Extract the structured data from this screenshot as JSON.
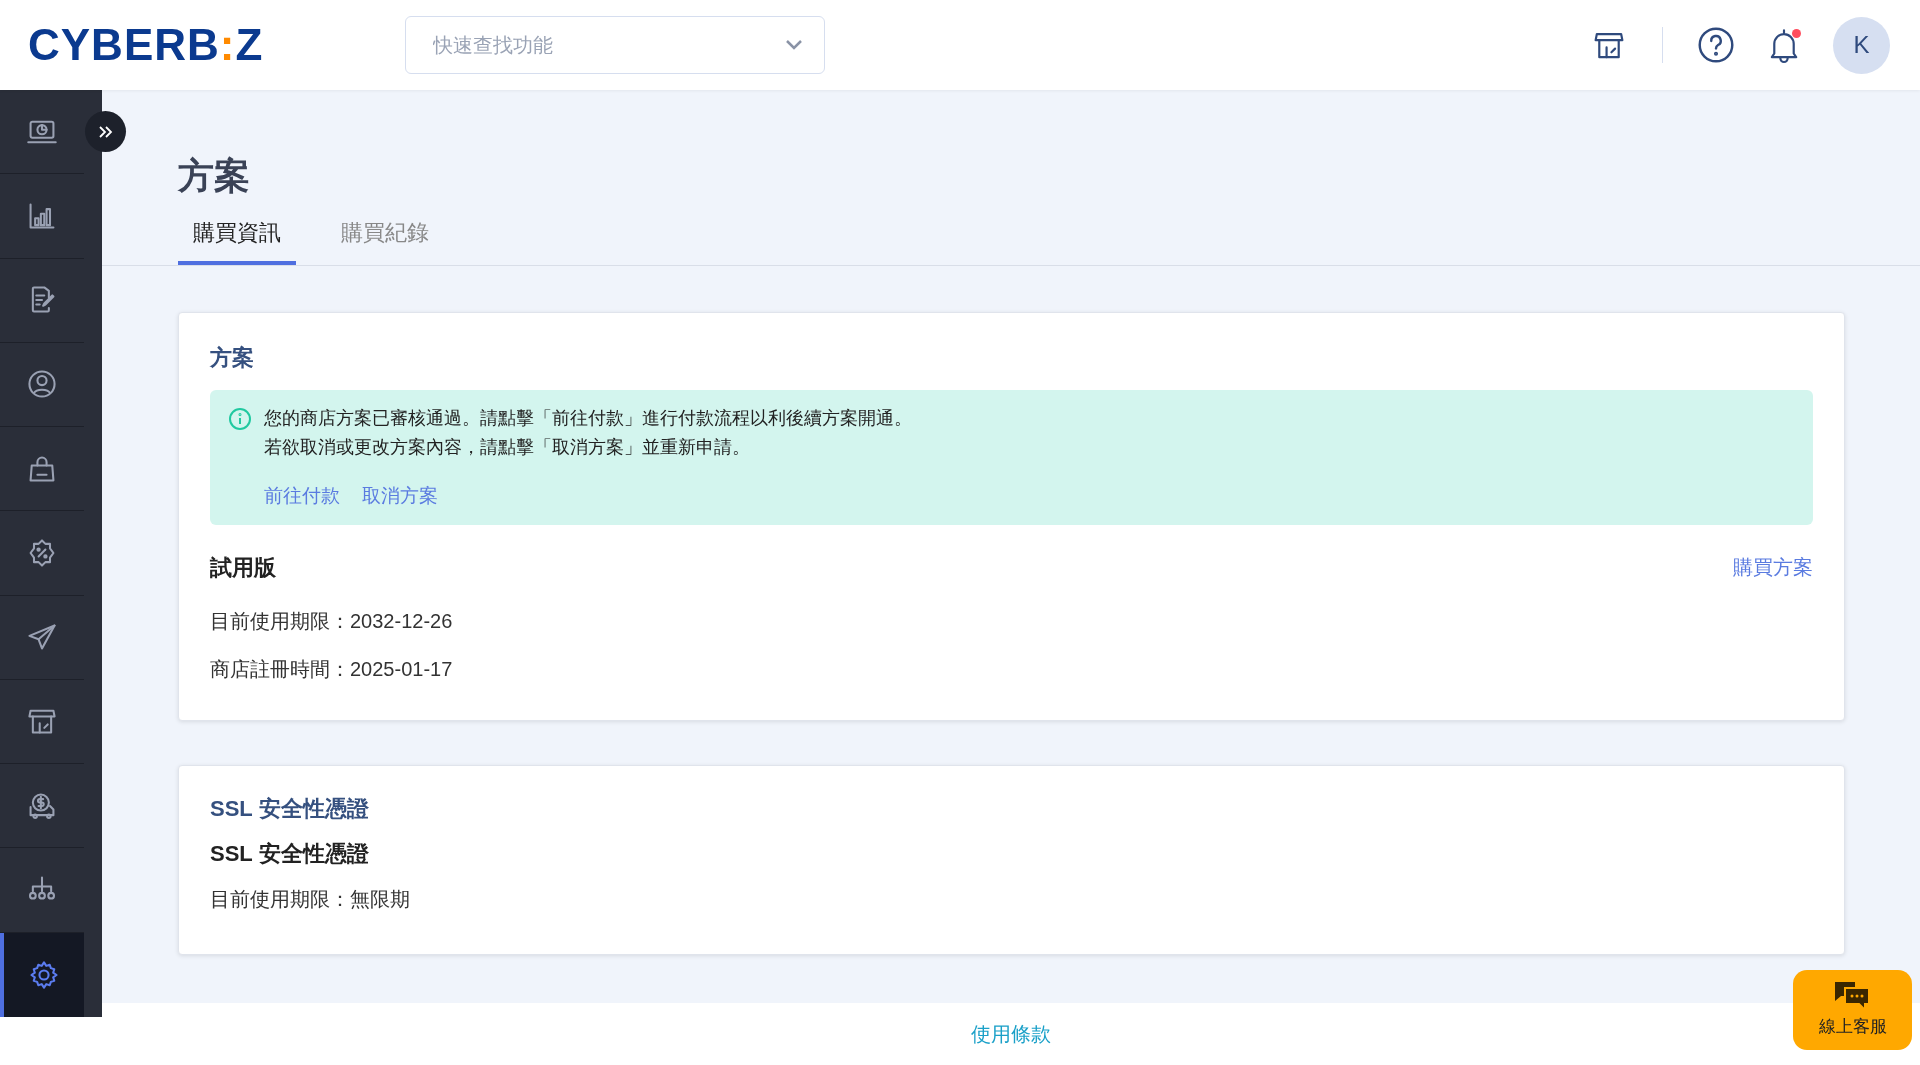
{
  "header": {
    "logo": {
      "before": "CYBERB",
      "mark": ":",
      "after": "Z"
    },
    "search": {
      "placeholder": "快速查找功能"
    },
    "notification_unread": true,
    "avatar": "K"
  },
  "sidebar": {
    "items": [
      {
        "selected": false
      },
      {
        "selected": false
      },
      {
        "selected": false
      },
      {
        "selected": false
      },
      {
        "selected": false
      },
      {
        "selected": false
      },
      {
        "selected": false
      },
      {
        "selected": false
      },
      {
        "selected": false
      },
      {
        "selected": false
      },
      {
        "selected": true
      }
    ]
  },
  "page": {
    "title": "方案",
    "tabs": [
      {
        "label": "購買資訊",
        "selected": true
      },
      {
        "label": "購買紀錄",
        "selected": false
      }
    ]
  },
  "plan_card": {
    "heading": "方案",
    "notice": {
      "lines": [
        "您的商店方案已審核通過。請點擊「前往付款」進行付款流程以利後續方案開通。",
        "若欲取消或更改方案內容，請點擊「取消方案」並重新申請。"
      ],
      "links": [
        "前往付款",
        "取消方案"
      ]
    },
    "plan_name": "試用版",
    "action": "購買方案",
    "details": [
      "目前使用期限：2032-12-26",
      "商店註冊時間：2025-01-17"
    ]
  },
  "ssl_card": {
    "heading": "SSL 安全性憑證",
    "name": "SSL 安全性憑證",
    "details": [
      "目前使用期限：無限期"
    ]
  },
  "footer": {
    "link": "使用條款"
  },
  "chat_button": {
    "label": "線上客服"
  }
}
